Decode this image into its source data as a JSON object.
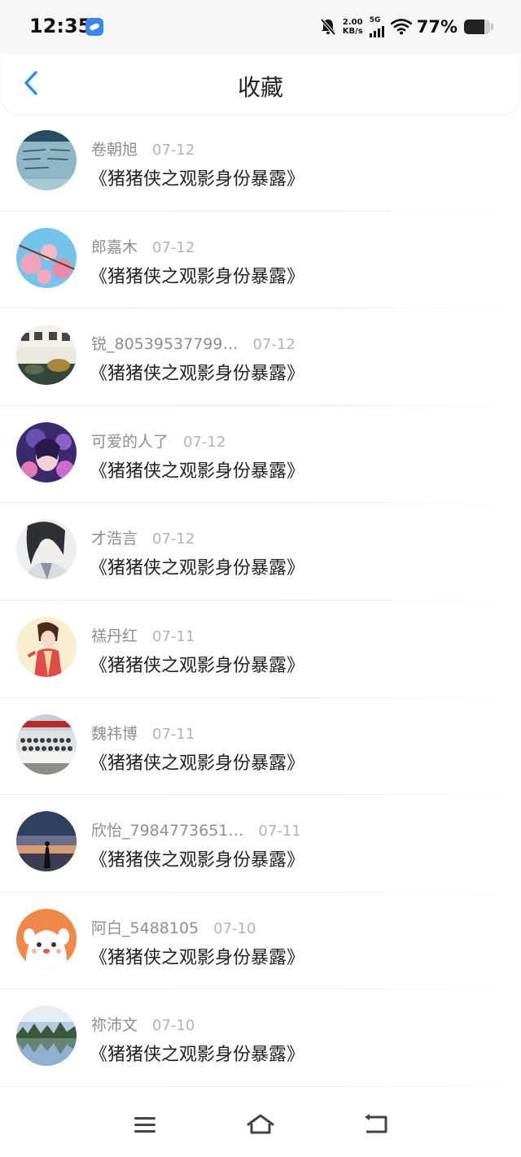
{
  "status_bar": {
    "time": "12:35",
    "net_speed_value": "2.00",
    "net_speed_unit": "KB/s",
    "network_type": "5G",
    "battery_percent": "77%",
    "battery_level": 0.77
  },
  "header": {
    "title": "收藏",
    "back_icon": "chevron-left-icon",
    "accent_color": "#2a8cf0"
  },
  "favorites": [
    {
      "user": "卷朝旭",
      "date": "07-12",
      "title": "《猪猪侠之观影身份暴露》"
    },
    {
      "user": "郎嘉木",
      "date": "07-12",
      "title": "《猪猪侠之观影身份暴露》"
    },
    {
      "user": "锐_80539537799…",
      "date": "07-12",
      "title": "《猪猪侠之观影身份暴露》"
    },
    {
      "user": "可爱的人了",
      "date": "07-12",
      "title": "《猪猪侠之观影身份暴露》"
    },
    {
      "user": "才浩言",
      "date": "07-12",
      "title": "《猪猪侠之观影身份暴露》"
    },
    {
      "user": "禚丹红",
      "date": "07-11",
      "title": "《猪猪侠之观影身份暴露》"
    },
    {
      "user": "魏祎博",
      "date": "07-11",
      "title": "《猪猪侠之观影身份暴露》"
    },
    {
      "user": "欣怡_7984773651…",
      "date": "07-11",
      "title": "《猪猪侠之观影身份暴露》"
    },
    {
      "user": "阿白_5488105",
      "date": "07-10",
      "title": "《猪猪侠之观影身份暴露》"
    },
    {
      "user": "祢沛文",
      "date": "07-10",
      "title": "《猪猪侠之观影身份暴露》"
    }
  ],
  "nav_bar": {
    "menu_icon": "menu-icon",
    "home_icon": "home-icon",
    "back_icon": "back-icon"
  }
}
